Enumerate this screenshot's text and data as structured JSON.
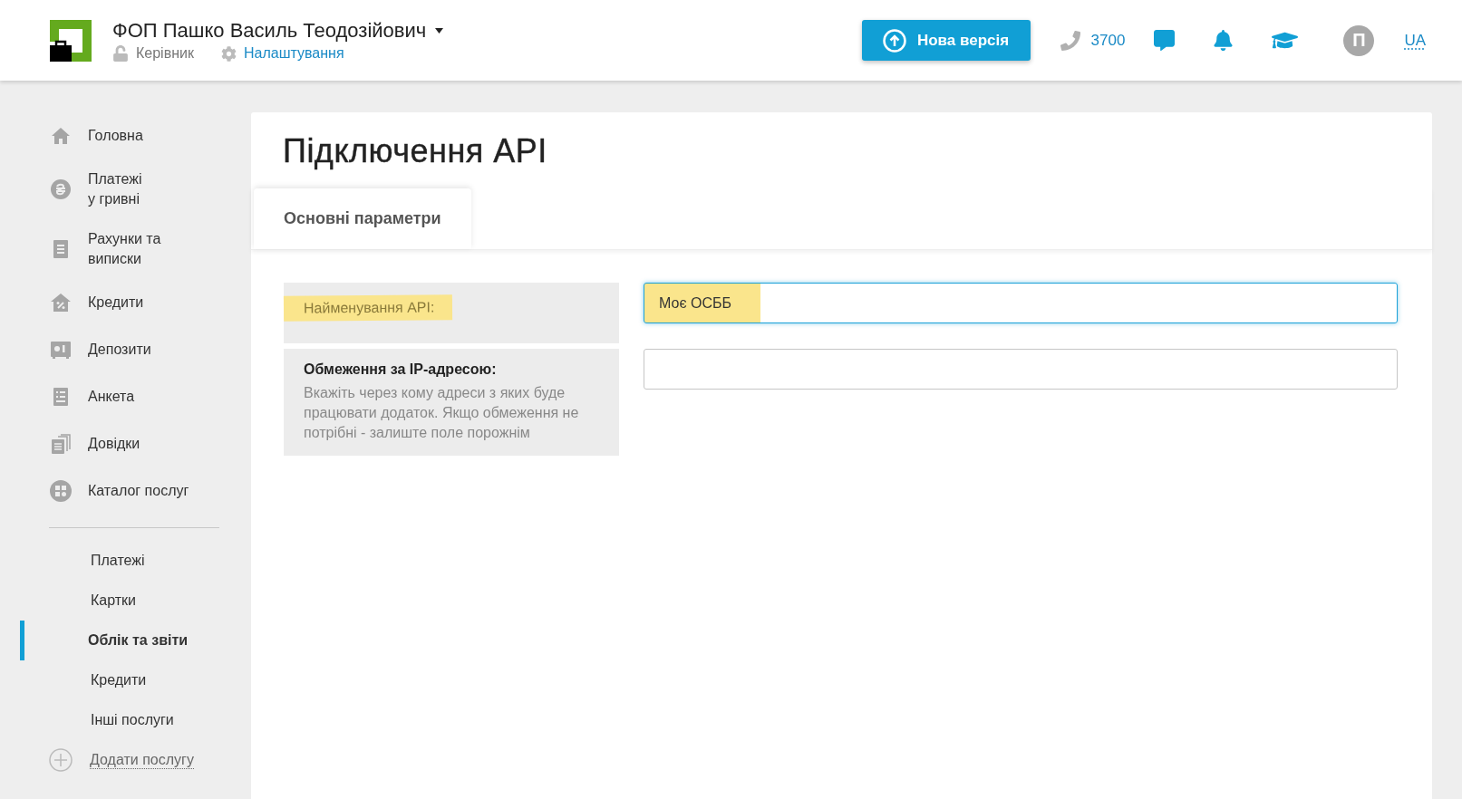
{
  "header": {
    "company": "ФОП Пашко Василь Теодозійович",
    "role": "Керівник",
    "settings_link": "Налаштування",
    "new_version_button": "Нова версія",
    "phone": "3700",
    "avatar_initial": "П",
    "languages": [
      {
        "label": "UA",
        "selected": true
      }
    ]
  },
  "sidebar": {
    "items": [
      {
        "label": "Головна"
      },
      {
        "label": "Платежі\nу гривні"
      },
      {
        "label": "Рахунки та\nвиписки"
      },
      {
        "label": "Кредити"
      },
      {
        "label": "Депозити"
      },
      {
        "label": "Анкета"
      },
      {
        "label": "Довідки"
      },
      {
        "label": "Каталог послуг"
      }
    ],
    "sub_items": [
      {
        "label": "Платежі",
        "selected": false
      },
      {
        "label": "Картки",
        "selected": false
      },
      {
        "label": "Облік та звіти",
        "selected": true
      },
      {
        "label": "Кредити",
        "selected": false
      },
      {
        "label": "Інші послуги",
        "selected": false
      }
    ],
    "add_service": "Додати послугу"
  },
  "page": {
    "title": "Підключення API",
    "tabs": [
      {
        "label": "Основні параметри",
        "selected": true
      }
    ],
    "fields": [
      {
        "kind": "plain",
        "label": "Найменування API:",
        "value": "Моє ОСББ",
        "focused": true,
        "highlighted": true
      },
      {
        "kind": "described",
        "label": "Обмеження за IP-адресою:",
        "hint": "Вкажіть через кому адреси з яких буде працювати додаток. Якщо обмеження не потрібні - залиште поле порожнім",
        "focused": false,
        "highlighted": false
      }
    ]
  }
}
